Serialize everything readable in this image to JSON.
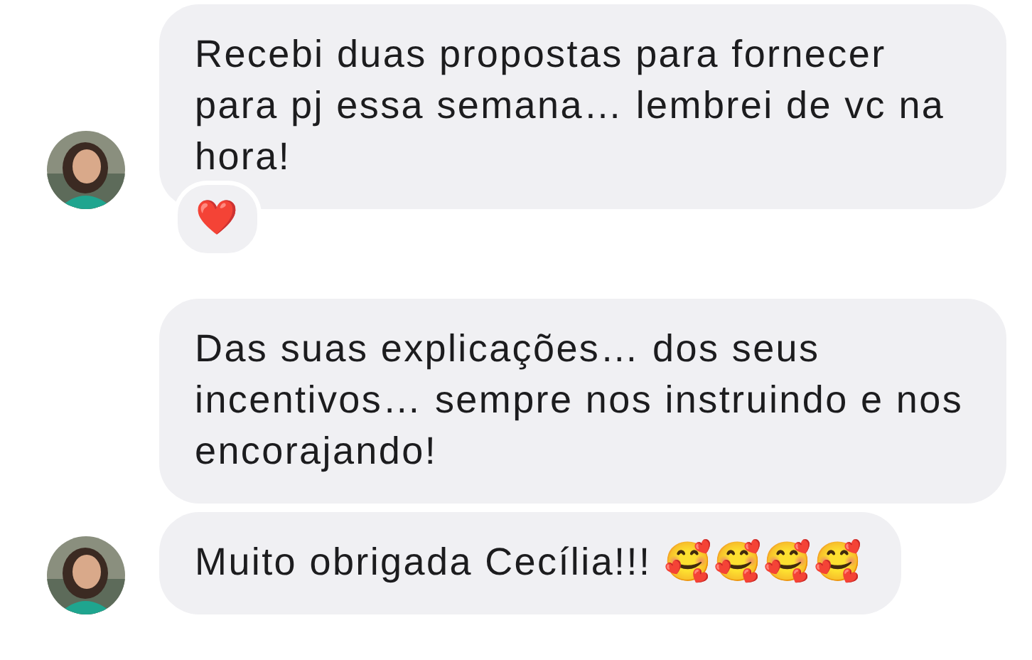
{
  "messages": [
    {
      "text": "Recebi duas propostas para fornecer para pj essa semana… lembrei de vc na hora!",
      "avatar": true,
      "reaction": "❤️"
    },
    {
      "text": "Das suas explicações… dos seus incentivos… sempre nos instruindo e nos encorajando!",
      "avatar": false
    },
    {
      "text": "Muito obrigada Cecília!!! 🥰🥰🥰🥰",
      "avatar": true
    }
  ]
}
